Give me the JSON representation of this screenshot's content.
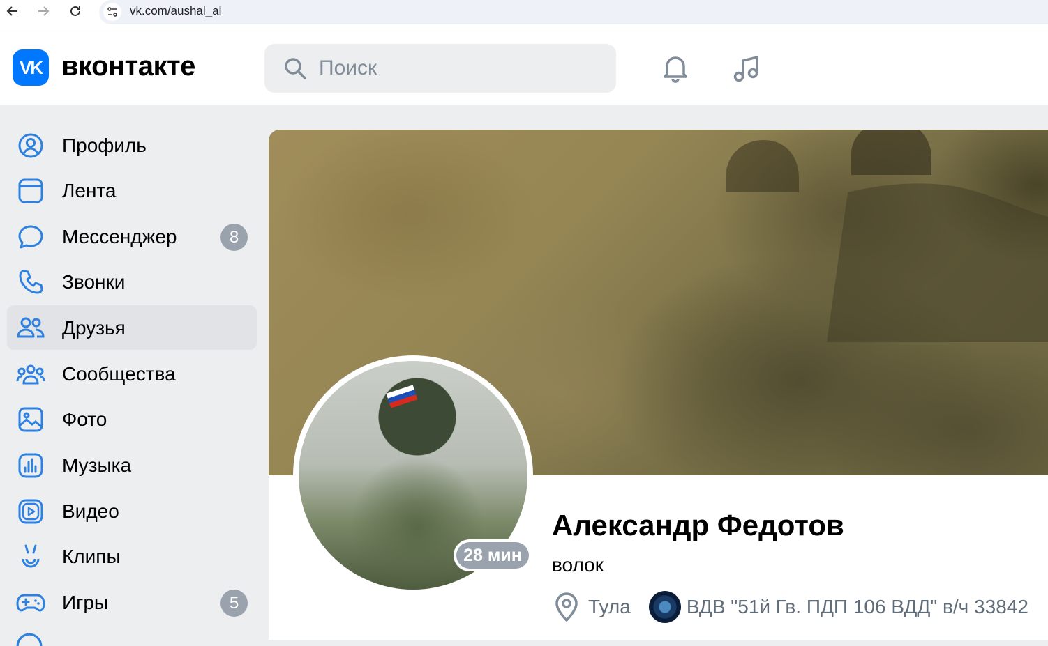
{
  "browser": {
    "url": "vk.com/aushal_al"
  },
  "header": {
    "logo_text": "VK",
    "brand": "вконтакте",
    "search_placeholder": "Поиск",
    "accent": "#0077ff"
  },
  "sidebar": {
    "items": [
      {
        "label": "Профиль",
        "icon": "profile-icon"
      },
      {
        "label": "Лента",
        "icon": "feed-icon"
      },
      {
        "label": "Мессенджер",
        "icon": "messenger-icon",
        "badge": "8"
      },
      {
        "label": "Звонки",
        "icon": "phone-icon"
      },
      {
        "label": "Друзья",
        "icon": "friends-icon",
        "active": true
      },
      {
        "label": "Сообщества",
        "icon": "communities-icon"
      },
      {
        "label": "Фото",
        "icon": "photo-icon"
      },
      {
        "label": "Музыка",
        "icon": "music-icon"
      },
      {
        "label": "Видео",
        "icon": "video-icon"
      },
      {
        "label": "Клипы",
        "icon": "clips-icon"
      },
      {
        "label": "Игры",
        "icon": "games-icon",
        "badge": "5"
      }
    ]
  },
  "profile": {
    "name": "Александр Федотов",
    "status": "волок",
    "online": "28 мин",
    "city": "Тула",
    "group": "ВДВ \"51й Гв. ПДП 106 ВДД\" в/ч 33842"
  }
}
